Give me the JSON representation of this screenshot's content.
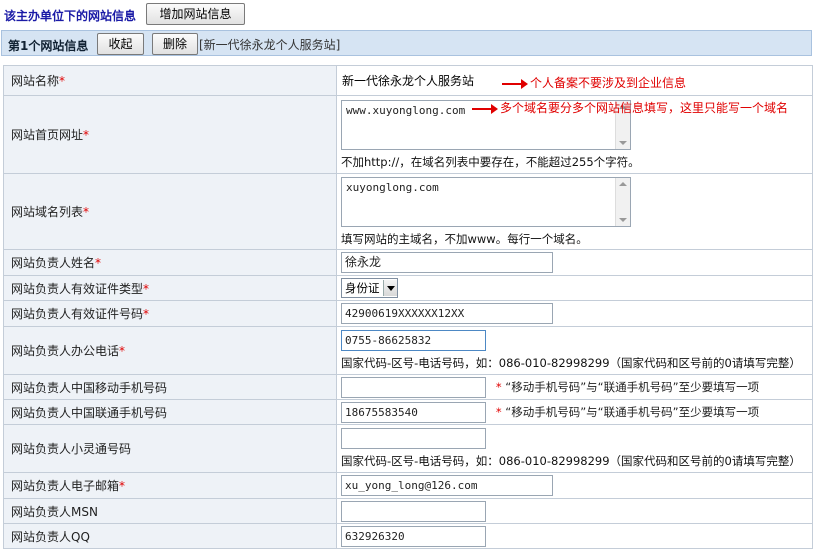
{
  "header": {
    "title": "该主办单位下的网站信息",
    "add_button": "增加网站信息"
  },
  "section": {
    "title": "第1个网站信息",
    "collapse_button": "收起",
    "delete_button": "删除",
    "site_tag": "[新一代徐永龙个人服务站]"
  },
  "fields": {
    "site_name": {
      "label": "网站名称",
      "value": "新一代徐永龙个人服务站"
    },
    "homepage_url": {
      "label": "网站首页网址",
      "value": "www.xuyonglong.com",
      "help": "不加http://，在域名列表中要存在，不能超过255个字符。"
    },
    "domain_list": {
      "label": "网站域名列表",
      "value": "xuyonglong.com",
      "help": "填写网站的主域名，不加www。每行一个域名。"
    },
    "owner_name": {
      "label": "网站负责人姓名",
      "value": "徐永龙"
    },
    "id_type": {
      "label": "网站负责人有效证件类型",
      "value": "身份证"
    },
    "id_number": {
      "label": "网站负责人有效证件号码",
      "value": "42900619XXXXXX12XX"
    },
    "office_phone": {
      "label": "网站负责人办公电话",
      "value": "0755-86625832",
      "help": "国家代码-区号-电话号码，如：086-010-82998299（国家代码和区号前的0请填写完整）"
    },
    "mobile_cmcc": {
      "label": "网站负责人中国移动手机号码",
      "value": "",
      "note": "“移动手机号码”与“联通手机号码”至少要填写一项"
    },
    "mobile_unicom": {
      "label": "网站负责人中国联通手机号码",
      "value": "18675583540",
      "note": "“移动手机号码”与“联通手机号码”至少要填写一项"
    },
    "phs": {
      "label": "网站负责人小灵通号码",
      "value": "",
      "help": "国家代码-区号-电话号码，如：086-010-82998299（国家代码和区号前的0请填写完整）"
    },
    "email": {
      "label": "网站负责人电子邮箱",
      "value": "xu_yong_long@126.com"
    },
    "msn": {
      "label": "网站负责人MSN",
      "value": ""
    },
    "qq": {
      "label": "网站负责人QQ",
      "value": "632926320"
    }
  },
  "required_mark": "*",
  "annotations": {
    "site_name": "个人备案不要涉及到企业信息",
    "homepage_url": "多个域名要分多个网站信息填写，这里只能写一个域名"
  },
  "colors": {
    "title_blue": "#1a1aa6",
    "required_red": "#e00000",
    "section_bg": "#d6e4f3",
    "label_bg": "#eef2f7"
  }
}
